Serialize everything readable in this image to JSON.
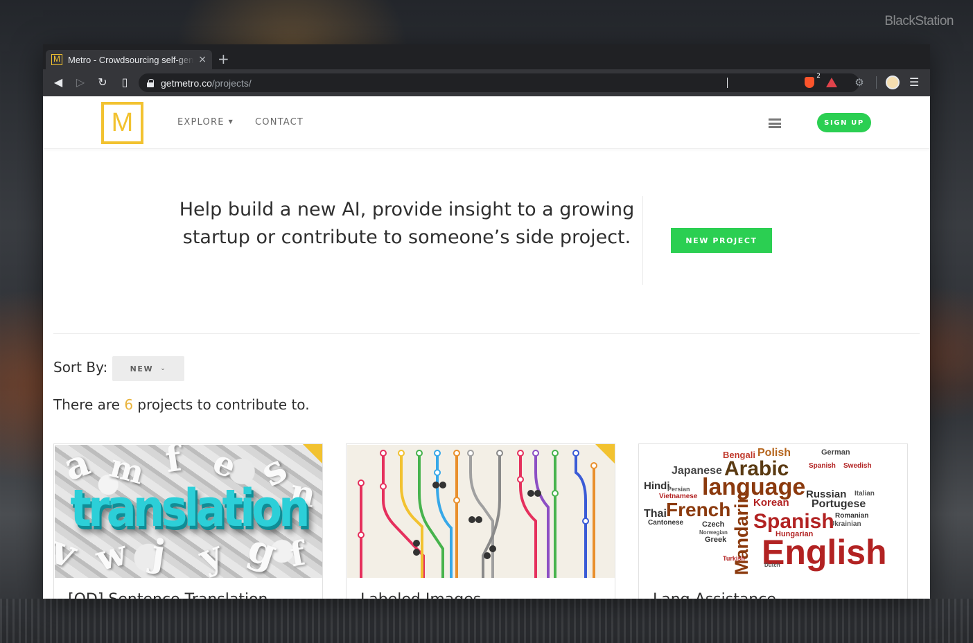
{
  "desktop": {
    "watermark": "BlackStation"
  },
  "browser": {
    "tab": {
      "title": "Metro - Crowdsourcing self-gen",
      "favicon": "M",
      "close_icon": "×"
    },
    "new_tab_icon": "+",
    "address": {
      "host": "getmetro.co",
      "path": "/projects/"
    },
    "brave_badge": "2"
  },
  "header": {
    "logo": "M",
    "nav": {
      "explore": "EXPLORE",
      "contact": "CONTACT"
    },
    "signup": "SIGN UP"
  },
  "hero": {
    "text": "Help build a new AI, provide insight to a growing startup or contribute to someone’s side project.",
    "new_project": "NEW PROJECT"
  },
  "sort": {
    "label": "Sort By:",
    "selected": "NEW"
  },
  "count": {
    "prefix": "There are ",
    "number": "6",
    "suffix": " projects to contribute to."
  },
  "cards": [
    {
      "image": "translation",
      "image_word": "translation",
      "title": "[OD] Sentence Translation"
    },
    {
      "image": "metro-lines",
      "title": "Labeled Images"
    },
    {
      "image": "language-cloud",
      "title": "Lang Assistance"
    }
  ],
  "language_cloud": [
    "Bengali",
    "Polish",
    "German",
    "Japanese",
    "Arabic",
    "Spanish",
    "Swedish",
    "Hindi",
    "Persian",
    "language",
    "Russian",
    "Italian",
    "Vietnamese",
    "Korean",
    "Thai",
    "French",
    "Portugese",
    "Cantonese",
    "Czech",
    "Norwegian",
    "Mandarin",
    "Romanian",
    "Ukrainian",
    "Greek",
    "Hungarian",
    "English",
    "Dutch",
    "Turkish"
  ],
  "colors": {
    "accent_yellow": "#f2c230",
    "primary_green": "#2bcf52",
    "count_highlight": "#e9b33b"
  }
}
